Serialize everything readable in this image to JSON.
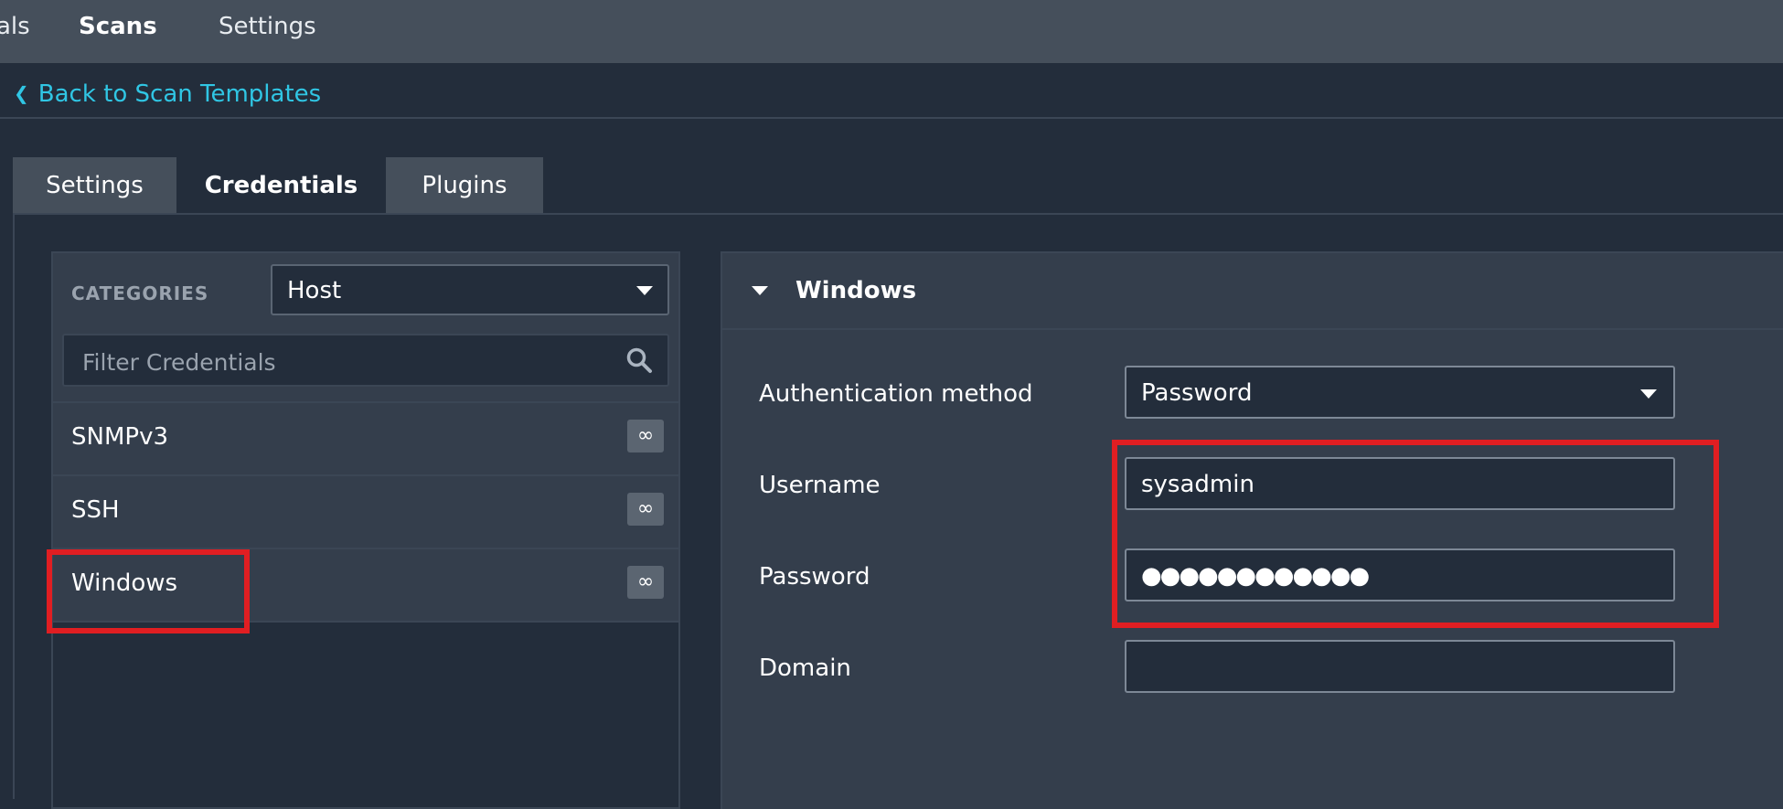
{
  "topbar": {
    "nav_partial": "als",
    "nav_scans": "Scans",
    "nav_settings": "Settings"
  },
  "back_link": "Back to Scan Templates",
  "tabs": [
    {
      "label": "Settings",
      "active": false
    },
    {
      "label": "Credentials",
      "active": true
    },
    {
      "label": "Plugins",
      "active": false
    }
  ],
  "categories": {
    "label": "CATEGORIES",
    "selected": "Host"
  },
  "filter": {
    "placeholder": "Filter Credentials"
  },
  "credential_items": [
    {
      "label": "SNMPv3",
      "badge": "∞"
    },
    {
      "label": "SSH",
      "badge": "∞"
    },
    {
      "label": "Windows",
      "badge": "∞"
    }
  ],
  "windows_panel": {
    "title": "Windows",
    "auth_method_label": "Authentication method",
    "auth_method_value": "Password",
    "username_label": "Username",
    "username_value": "sysadmin",
    "password_label": "Password",
    "password_value": "●●●●●●●●●●●●",
    "domain_label": "Domain",
    "domain_value": ""
  },
  "colors": {
    "accent": "#30c6e4",
    "highlight": "#e01e22",
    "background": "#232d3b",
    "panel": "#343e4c"
  }
}
